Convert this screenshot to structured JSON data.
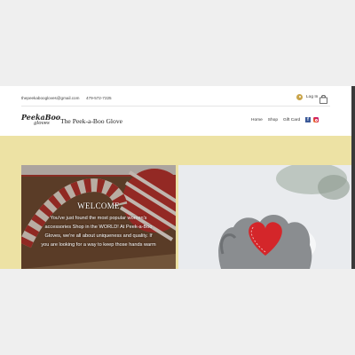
{
  "topbar": {
    "email": "thepeekaboogloves@gmail.com",
    "phone": "479-572-7225",
    "login_label": "Log In",
    "cart_count": "0"
  },
  "header": {
    "logo_text": "PeekaBoo",
    "logo_sub": "gloves",
    "site_title": "The Peek-a-Boo Glove",
    "menu": [
      "Home",
      "Shop",
      "Gift Card"
    ],
    "social": [
      "facebook-icon",
      "instagram-icon"
    ]
  },
  "hero": {
    "title": "WELCOME",
    "text": "You've just found the most popular women's accessories Shop in the WORLD! At Peek-a-Boo Gloves, we're all about uniqueness and quality. If you are looking for a way to keep those hands warm"
  },
  "colors": {
    "banner": "#ede2a4",
    "facebook": "#3b5998"
  }
}
